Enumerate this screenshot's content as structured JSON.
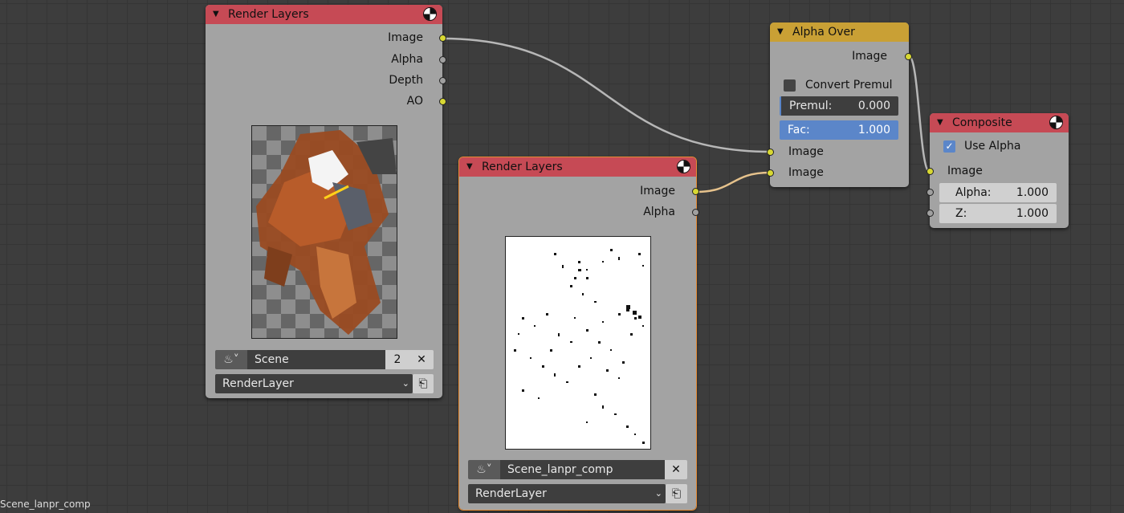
{
  "status_text": "Scene_lanpr_comp",
  "colors": {
    "render_layers_header": "#c64a55",
    "alpha_over_header": "#c9a035",
    "composite_header": "#c64a55",
    "socket_color": "#d8d833",
    "active_outline": "#e68b33"
  },
  "node_render_layers_1": {
    "title": "Render Layers",
    "outputs": [
      "Image",
      "Alpha",
      "Depth",
      "AO"
    ],
    "scene_name": "Scene",
    "scene_users": "2",
    "layer": "RenderLayer",
    "preview": "robot render with transparent background"
  },
  "node_render_layers_2": {
    "title": "Render Layers",
    "outputs": [
      "Image",
      "Alpha"
    ],
    "scene_name": "Scene_lanpr_comp",
    "layer": "RenderLayer",
    "preview": "black line dots on white"
  },
  "node_alpha_over": {
    "title": "Alpha Over",
    "output": "Image",
    "convert_premul_label": "Convert Premul",
    "convert_premul_checked": false,
    "premul": {
      "label": "Premul:",
      "value": "0.000"
    },
    "fac": {
      "label": "Fac:",
      "value": "1.000"
    },
    "inputs": [
      "Image",
      "Image"
    ]
  },
  "node_composite": {
    "title": "Composite",
    "use_alpha_label": "Use Alpha",
    "use_alpha_checked": true,
    "input": "Image",
    "alpha": {
      "label": "Alpha:",
      "value": "1.000"
    },
    "z": {
      "label": "Z:",
      "value": "1.000"
    }
  }
}
